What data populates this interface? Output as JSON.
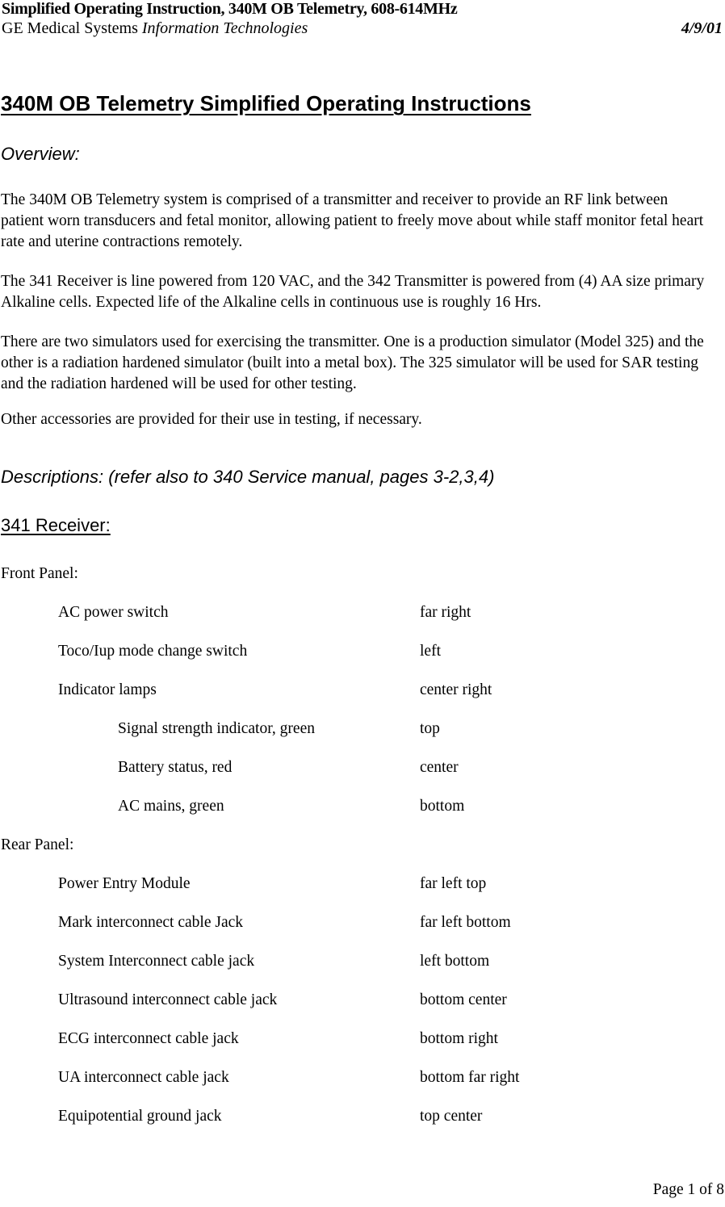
{
  "header": {
    "line1": "Simplified Operating Instruction, 340M OB Telemetry, 608-614MHz",
    "org_plain": "GE Medical Systems ",
    "org_italic": "Information Technologies",
    "date": "4/9/01"
  },
  "title": "340M OB Telemetry Simplified Operating Instructions",
  "overview": {
    "heading": "Overview:",
    "paragraphs": [
      "The 340M OB Telemetry system is comprised of a transmitter and receiver to provide an RF link between patient worn transducers and fetal monitor, allowing patient to freely move about while staff monitor fetal heart rate and uterine contractions remotely.",
      "The 341 Receiver is line powered from 120 VAC, and the 342 Transmitter is powered from (4) AA size primary Alkaline cells. Expected life of the Alkaline cells in continuous use is roughly 16 Hrs.",
      "There are two simulators used for exercising the transmitter. One is a production simulator (Model 325) and the other is a radiation hardened simulator (built into a metal box). The 325 simulator will be used for SAR testing and the radiation hardened will be used for other testing.",
      "Other accessories are provided for their use in testing, if necessary."
    ]
  },
  "descriptions": {
    "heading": "Descriptions: (refer also to 340 Service manual, pages 3-2,3,4)",
    "subheading": "341 Receiver:",
    "front_panel": {
      "label": "Front Panel:",
      "rows": [
        {
          "name": "AC power switch",
          "value": "far right",
          "level": 1
        },
        {
          "name": "Toco/Iup mode change switch",
          "value": "left",
          "level": 1
        },
        {
          "name": "Indicator lamps",
          "value": "center right",
          "level": 1
        },
        {
          "name": "Signal strength indicator, green",
          "value": "top",
          "level": 2
        },
        {
          "name": "Battery status, red",
          "value": "center",
          "level": 2
        },
        {
          "name": "AC mains, green",
          "value": "bottom",
          "level": 2
        }
      ]
    },
    "rear_panel": {
      "label": "Rear Panel:",
      "rows": [
        {
          "name": "Power Entry Module",
          "value": "far left top",
          "level": 1
        },
        {
          "name": "Mark interconnect cable Jack",
          "value": "far left bottom",
          "level": 1
        },
        {
          "name": "System Interconnect cable jack",
          "value": "left bottom",
          "level": 1
        },
        {
          "name": "Ultrasound interconnect cable jack",
          "value": "bottom center",
          "level": 1
        },
        {
          "name": "ECG interconnect cable jack",
          "value": "bottom right",
          "level": 1
        },
        {
          "name": "UA interconnect cable jack",
          "value": "bottom far right",
          "level": 1
        },
        {
          "name": "Equipotential ground jack",
          "value": "top center",
          "level": 1
        }
      ]
    }
  },
  "footer": {
    "page_label": "Page 1 of 8"
  }
}
